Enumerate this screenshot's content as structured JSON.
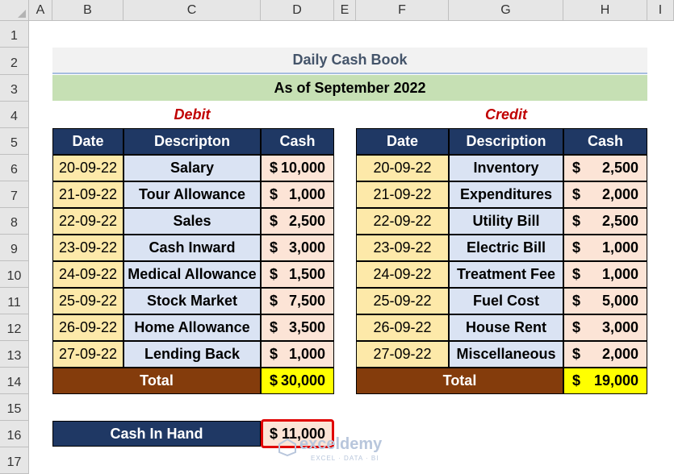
{
  "columns": [
    "A",
    "B",
    "C",
    "D",
    "E",
    "F",
    "G",
    "H",
    "I"
  ],
  "rows": [
    "1",
    "2",
    "3",
    "4",
    "5",
    "6",
    "7",
    "8",
    "9",
    "10",
    "11",
    "12",
    "13",
    "14",
    "15",
    "16",
    "17"
  ],
  "title": "Daily Cash Book",
  "subtitle": "As of September 2022",
  "debit": {
    "label": "Debit",
    "headers": [
      "Date",
      "Descripton",
      "Cash"
    ],
    "rows": [
      {
        "date": "20-09-22",
        "desc": "Salary",
        "cur": "$",
        "amt": "10,000"
      },
      {
        "date": "21-09-22",
        "desc": "Tour Allowance",
        "cur": "$",
        "amt": "1,000"
      },
      {
        "date": "22-09-22",
        "desc": "Sales",
        "cur": "$",
        "amt": "2,500"
      },
      {
        "date": "23-09-22",
        "desc": "Cash Inward",
        "cur": "$",
        "amt": "3,000"
      },
      {
        "date": "24-09-22",
        "desc": "Medical Allowance",
        "cur": "$",
        "amt": "1,500"
      },
      {
        "date": "25-09-22",
        "desc": "Stock Market",
        "cur": "$",
        "amt": "7,500"
      },
      {
        "date": "26-09-22",
        "desc": "Home Allowance",
        "cur": "$",
        "amt": "3,500"
      },
      {
        "date": "27-09-22",
        "desc": "Lending Back",
        "cur": "$",
        "amt": "1,000"
      }
    ],
    "total_label": "Total",
    "total_cur": "$",
    "total_amt": "30,000"
  },
  "credit": {
    "label": "Credit",
    "headers": [
      "Date",
      "Description",
      "Cash"
    ],
    "rows": [
      {
        "date": "20-09-22",
        "desc": "Inventory",
        "cur": "$",
        "amt": "2,500"
      },
      {
        "date": "21-09-22",
        "desc": "Expenditures",
        "cur": "$",
        "amt": "2,000"
      },
      {
        "date": "22-09-22",
        "desc": "Utility Bill",
        "cur": "$",
        "amt": "2,500"
      },
      {
        "date": "23-09-22",
        "desc": "Electric Bill",
        "cur": "$",
        "amt": "1,000"
      },
      {
        "date": "24-09-22",
        "desc": "Treatment Fee",
        "cur": "$",
        "amt": "1,000"
      },
      {
        "date": "25-09-22",
        "desc": "Fuel Cost",
        "cur": "$",
        "amt": "5,000"
      },
      {
        "date": "26-09-22",
        "desc": "House Rent",
        "cur": "$",
        "amt": "3,000"
      },
      {
        "date": "27-09-22",
        "desc": "Miscellaneous",
        "cur": "$",
        "amt": "2,000"
      }
    ],
    "total_label": "Total",
    "total_cur": "$",
    "total_amt": "19,000"
  },
  "cash_in_hand": {
    "label": "Cash In Hand",
    "cur": "$",
    "amt": "11,000"
  },
  "watermark": {
    "name": "exceldemy",
    "tagline": "EXCEL · DATA · BI"
  }
}
